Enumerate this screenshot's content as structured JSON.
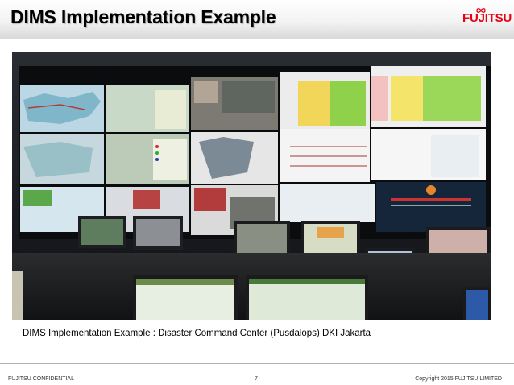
{
  "slide": {
    "title": "DIMS Implementation Example",
    "logo_text": "FUJITSU",
    "caption": "DIMS Implementation Example : Disaster Command Center (Pusdalops) DKI Jakarta"
  },
  "footer": {
    "left": "FUJITSU CONFIDENTIAL",
    "page": "7",
    "right": "Copyright 2015 FUJITSU LIMITED"
  },
  "colors": {
    "logo_red": "#e60012",
    "title_text": "#000000"
  }
}
